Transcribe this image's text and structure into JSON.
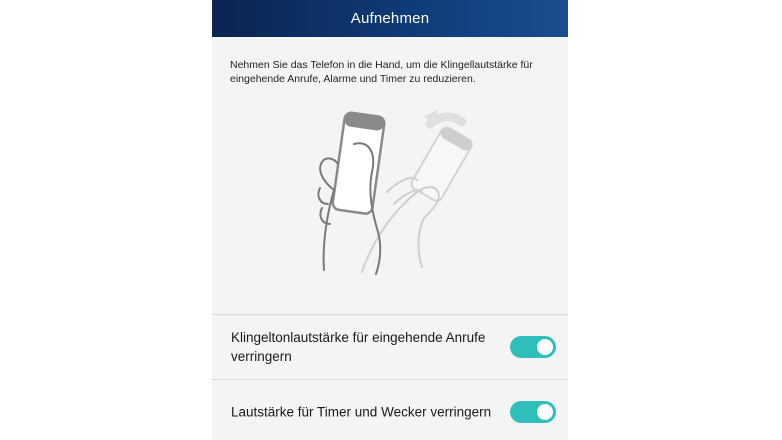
{
  "header": {
    "title": "Aufnehmen"
  },
  "description": "Nehmen Sie das Telefon in die Hand, um die Klingellautstärke für eingehende Anrufe, Alarme und Timer zu reduzieren.",
  "illustration": {
    "icon": "pick-up-phone-gesture-illustration"
  },
  "settings": [
    {
      "label": "Klingeltonlautstärke für eingehende Anrufe verringern",
      "enabled": true
    },
    {
      "label": "Lautstärke für Timer und Wecker verringern",
      "enabled": true
    }
  ],
  "colors": {
    "header_dark": "#0b2450",
    "header_light": "#1b4d8f",
    "toggle_on": "#2fbfba",
    "background": "#f4f4f4"
  }
}
